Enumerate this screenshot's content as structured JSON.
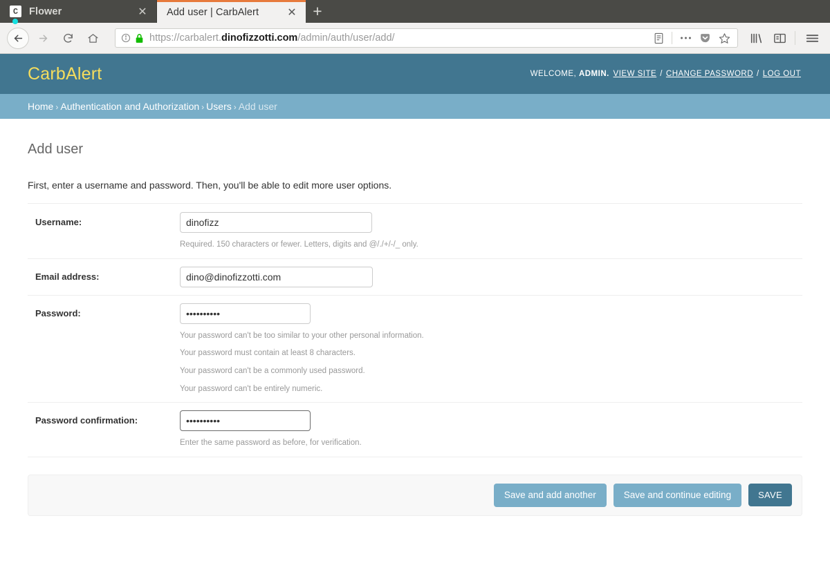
{
  "browser": {
    "tabs": [
      {
        "title": "Flower",
        "favicon_letter": "C",
        "active": false,
        "has_audio_indicator": true
      },
      {
        "title": "Add user | CarbAlert",
        "active": true,
        "has_audio_indicator": false
      }
    ],
    "new_tab_label": "+",
    "close_label": "✕",
    "nav": {
      "back": "←",
      "forward": "→",
      "reload": "↻",
      "home": "⌂"
    },
    "url": {
      "scheme": "https://",
      "subdomain": "carbalert.",
      "domain": "dinofizzotti.com",
      "path": "/admin/auth/user/add/",
      "full": "https://carbalert.dinofizzotti.com/admin/auth/user/add/"
    },
    "accent_color": "#e77a3c",
    "chrome_bg": "#f2f1f0",
    "tabstrip_bg": "#4a4a46"
  },
  "site": {
    "branding": "CarbAlert",
    "branding_color": "#f5dd5d",
    "header_bg": "#417690",
    "breadcrumb_bg": "#79aec8",
    "user_tools": {
      "welcome": "WELCOME,",
      "username": "ADMIN.",
      "links": [
        {
          "label": "VIEW SITE"
        },
        {
          "label": "CHANGE PASSWORD"
        },
        {
          "label": "LOG OUT"
        }
      ],
      "separator": "/"
    },
    "breadcrumbs": [
      {
        "label": "Home",
        "current": false
      },
      {
        "label": "Authentication and Authorization",
        "current": false
      },
      {
        "label": "Users",
        "current": false
      },
      {
        "label": "Add user",
        "current": true
      }
    ],
    "breadcrumb_separator": "›"
  },
  "main": {
    "title": "Add user",
    "intro": "First, enter a username and password. Then, you'll be able to edit more user options.",
    "fields": {
      "username": {
        "label": "Username:",
        "value": "dinofizz",
        "help": "Required. 150 characters or fewer. Letters, digits and @/./+/-/_ only."
      },
      "email": {
        "label": "Email address:",
        "value": "dino@dinofizzotti.com"
      },
      "password": {
        "label": "Password:",
        "value": "••••••••••",
        "help_lines": [
          "Your password can't be too similar to your other personal information.",
          "Your password must contain at least 8 characters.",
          "Your password can't be a commonly used password.",
          "Your password can't be entirely numeric."
        ]
      },
      "password_confirmation": {
        "label": "Password confirmation:",
        "value": "••••••••••",
        "help": "Enter the same password as before, for verification.",
        "focused": true
      }
    },
    "buttons": {
      "save_and_add_another": "Save and add another",
      "save_and_continue": "Save and continue editing",
      "save": "SAVE"
    }
  }
}
